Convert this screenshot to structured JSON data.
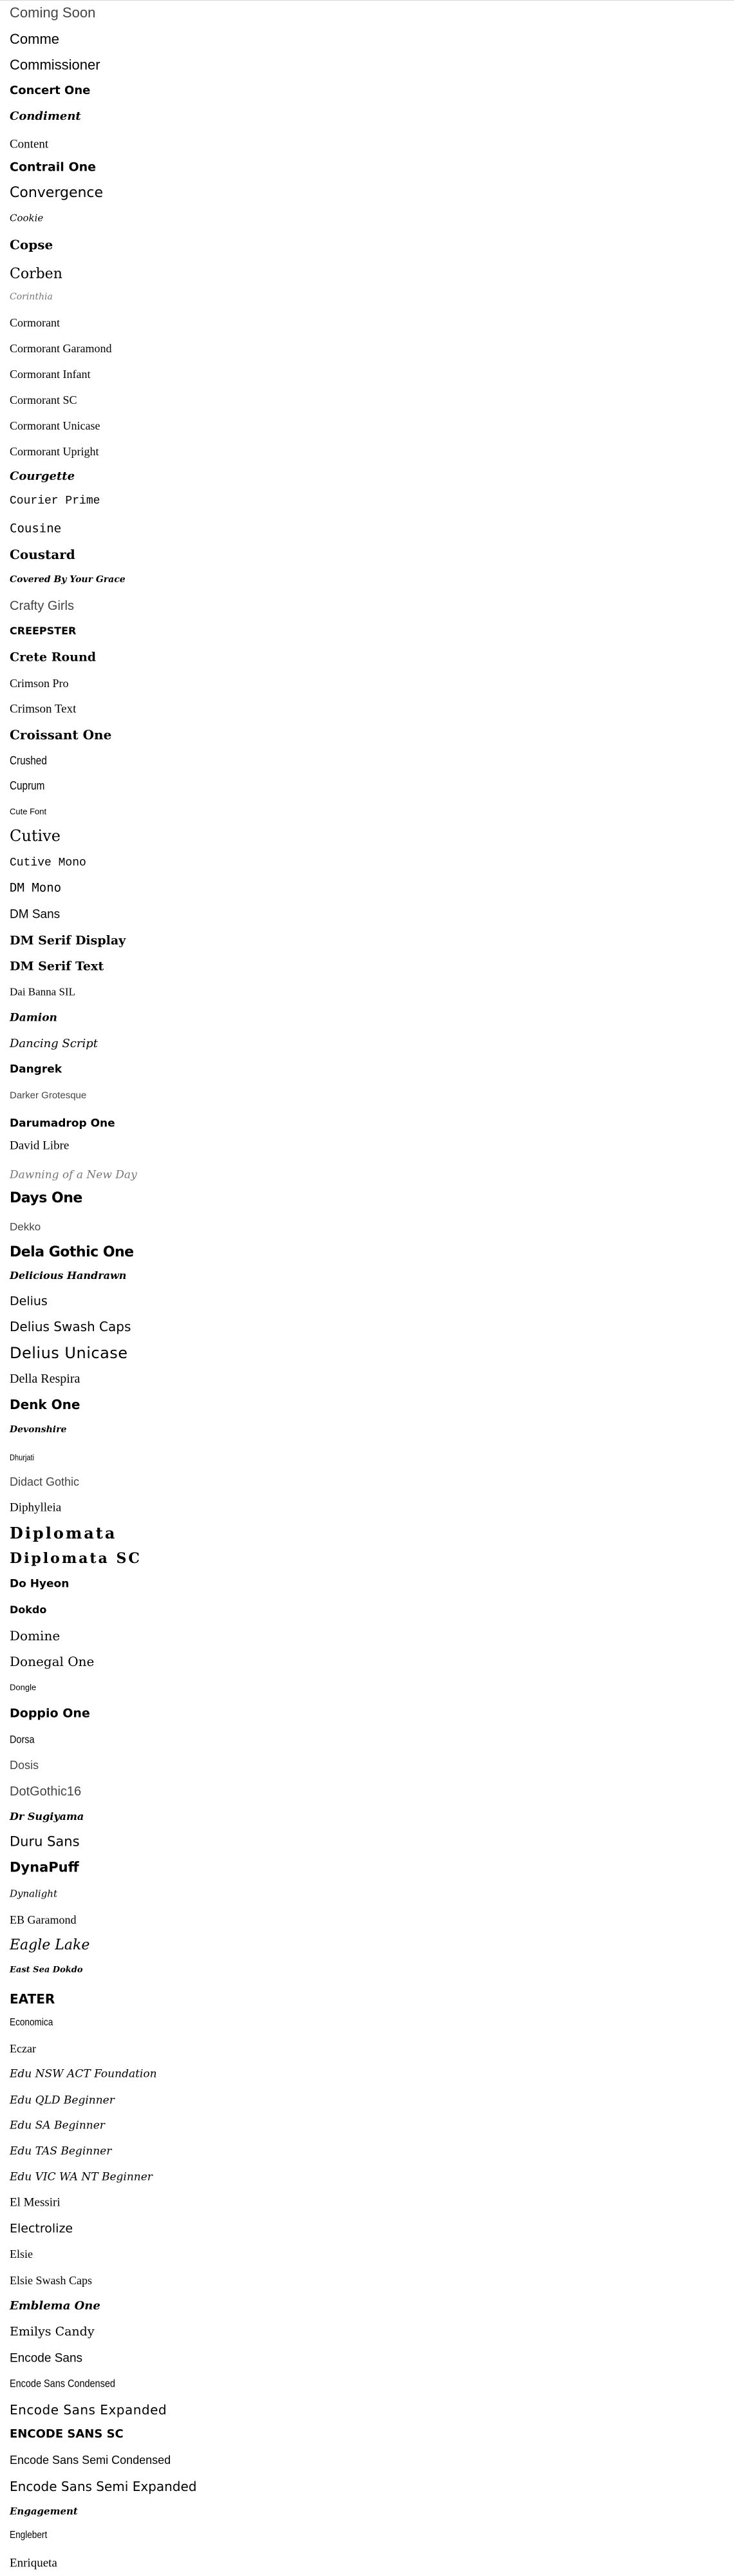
{
  "fonts": [
    {
      "label": "Coming Soon",
      "style": "light"
    },
    {
      "label": "Comme",
      "style": "sans"
    },
    {
      "label": "Commissioner",
      "style": "sans"
    },
    {
      "label": "Concert One",
      "style": "bold"
    },
    {
      "label": "Condiment",
      "style": "bscript"
    },
    {
      "label": "Content",
      "style": "serif"
    },
    {
      "label": "Contrail One",
      "style": "bold"
    },
    {
      "label": "Convergence",
      "style": "dsans"
    },
    {
      "label": "Cookie",
      "style": "script"
    },
    {
      "label": "Copse",
      "style": "sbold"
    },
    {
      "label": "Corben",
      "style": "dserif"
    },
    {
      "label": "Corinthia",
      "style": "thin"
    },
    {
      "label": "Cormorant",
      "style": "serif"
    },
    {
      "label": "Cormorant Garamond",
      "style": "serif"
    },
    {
      "label": "Cormorant Infant",
      "style": "serif"
    },
    {
      "label": "Cormorant SC",
      "style": "serif"
    },
    {
      "label": "Cormorant Unicase",
      "style": "serif"
    },
    {
      "label": "Cormorant Upright",
      "style": "serif"
    },
    {
      "label": "Courgette",
      "style": "bscript"
    },
    {
      "label": "Courier Prime",
      "style": "mono"
    },
    {
      "label": "Cousine",
      "style": "dmono"
    },
    {
      "label": "Coustard",
      "style": "sbold"
    },
    {
      "label": "Covered By Your Grace",
      "style": "bscript"
    },
    {
      "label": "Crafty Girls",
      "style": "light"
    },
    {
      "label": "Creepster",
      "style": "caps"
    },
    {
      "label": "Crete Round",
      "style": "sbold"
    },
    {
      "label": "Crimson Pro",
      "style": "serif"
    },
    {
      "label": "Crimson Text",
      "style": "serif"
    },
    {
      "label": "Croissant One",
      "style": "sbold"
    },
    {
      "label": "Crushed",
      "style": "cond"
    },
    {
      "label": "Cuprum",
      "style": "cond"
    },
    {
      "label": "Cute Font",
      "style": "sans"
    },
    {
      "label": "Cutive",
      "style": "dserif"
    },
    {
      "label": "Cutive Mono",
      "style": "mono"
    },
    {
      "label": "DM Mono",
      "style": "dmono"
    },
    {
      "label": "DM Sans",
      "style": "sans"
    },
    {
      "label": "DM Serif Display",
      "style": "sbold"
    },
    {
      "label": "DM Serif Text",
      "style": "sbold"
    },
    {
      "label": "Dai Banna SIL",
      "style": "serif"
    },
    {
      "label": "Damion",
      "style": "bscript"
    },
    {
      "label": "Dancing Script",
      "style": "script"
    },
    {
      "label": "Dangrek",
      "style": "bold"
    },
    {
      "label": "Darker Grotesque",
      "style": "light"
    },
    {
      "label": "Darumadrop One",
      "style": "bold"
    },
    {
      "label": "David Libre",
      "style": "serif"
    },
    {
      "label": "Dawning of a New Day",
      "style": "thin"
    },
    {
      "label": "Days One",
      "style": "heavy"
    },
    {
      "label": "Dekko",
      "style": "light"
    },
    {
      "label": "Dela Gothic One",
      "style": "heavy"
    },
    {
      "label": "Delicious Handrawn",
      "style": "bscript"
    },
    {
      "label": "Delius",
      "style": "dsans"
    },
    {
      "label": "Delius Swash Caps",
      "style": "dsans"
    },
    {
      "label": "Delius Unicase",
      "style": "wide"
    },
    {
      "label": "Della Respira",
      "style": "serif"
    },
    {
      "label": "Denk One",
      "style": "bold"
    },
    {
      "label": "Devonshire",
      "style": "bscript"
    },
    {
      "label": "Dhurjati",
      "style": "cond"
    },
    {
      "label": "Didact Gothic",
      "style": "light"
    },
    {
      "label": "Diphylleia",
      "style": "serif"
    },
    {
      "label": "Diplomata",
      "style": "scaps"
    },
    {
      "label": "Diplomata SC",
      "style": "scaps"
    },
    {
      "label": "Do Hyeon",
      "style": "bold"
    },
    {
      "label": "Dokdo",
      "style": "bold"
    },
    {
      "label": "Domine",
      "style": "dserif"
    },
    {
      "label": "Donegal One",
      "style": "dserif"
    },
    {
      "label": "Dongle",
      "style": "sans"
    },
    {
      "label": "Doppio One",
      "style": "bold"
    },
    {
      "label": "Dorsa",
      "style": "cond"
    },
    {
      "label": "Dosis",
      "style": "light"
    },
    {
      "label": "DotGothic16",
      "style": "light"
    },
    {
      "label": "Dr Sugiyama",
      "style": "bscript"
    },
    {
      "label": "Duru Sans",
      "style": "dsans"
    },
    {
      "label": "DynaPuff",
      "style": "bold"
    },
    {
      "label": "Dynalight",
      "style": "script"
    },
    {
      "label": "EB Garamond",
      "style": "serif"
    },
    {
      "label": "Eagle Lake",
      "style": "script"
    },
    {
      "label": "East Sea Dokdo",
      "style": "bscript"
    },
    {
      "label": "Eater",
      "style": "caps"
    },
    {
      "label": "Economica",
      "style": "cond"
    },
    {
      "label": "Eczar",
      "style": "serif"
    },
    {
      "label": "Edu NSW ACT Foundation",
      "style": "script"
    },
    {
      "label": "Edu QLD Beginner",
      "style": "script"
    },
    {
      "label": "Edu SA Beginner",
      "style": "script"
    },
    {
      "label": "Edu TAS Beginner",
      "style": "script"
    },
    {
      "label": "Edu VIC WA NT Beginner",
      "style": "script"
    },
    {
      "label": "El Messiri",
      "style": "serif"
    },
    {
      "label": "Electrolize",
      "style": "dsans"
    },
    {
      "label": "Elsie",
      "style": "serif"
    },
    {
      "label": "Elsie Swash Caps",
      "style": "serif"
    },
    {
      "label": "Emblema One",
      "style": "bscript"
    },
    {
      "label": "Emilys Candy",
      "style": "dserif"
    },
    {
      "label": "Encode Sans",
      "style": "sans"
    },
    {
      "label": "Encode Sans Condensed",
      "style": "cond"
    },
    {
      "label": "Encode Sans Expanded",
      "style": "wide"
    },
    {
      "label": "Encode Sans SC",
      "style": "caps"
    },
    {
      "label": "Encode Sans Semi Condensed",
      "style": "sans"
    },
    {
      "label": "Encode Sans Semi Expanded",
      "style": "dsans"
    },
    {
      "label": "Engagement",
      "style": "bscript"
    },
    {
      "label": "Englebert",
      "style": "cond"
    },
    {
      "label": "Enriqueta",
      "style": "serif"
    }
  ]
}
